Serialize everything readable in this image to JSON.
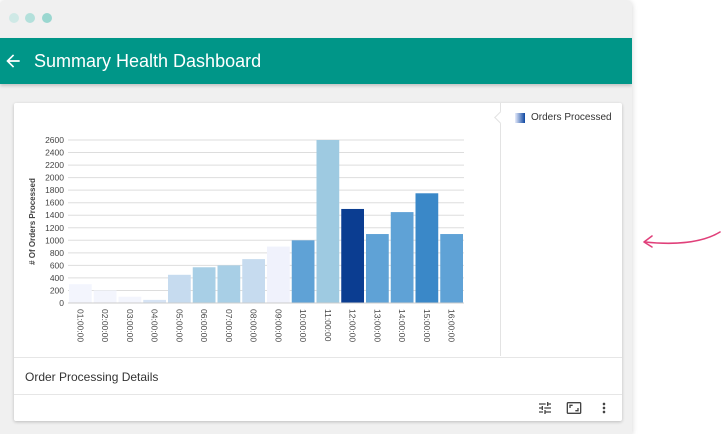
{
  "window": {
    "dots": [
      "#cfe9e6",
      "#b3e0db",
      "#9ad7d0"
    ]
  },
  "header": {
    "title": "Summary Health Dashboard",
    "back_icon": "arrow-left-icon",
    "color": "#009688"
  },
  "legend": {
    "label": "Orders Processed"
  },
  "details": {
    "title": "Order Processing Details"
  },
  "toolbar": {
    "icons": [
      "tune-icon",
      "fullscreen-icon",
      "more-vert-icon"
    ]
  },
  "accent_arrow_color": "#e0407a",
  "chart_data": {
    "type": "bar",
    "categories": [
      "01:00:00",
      "02:00:00",
      "03:00:00",
      "04:00:00",
      "05:00:00",
      "06:00:00",
      "07:00:00",
      "08:00:00",
      "09:00:00",
      "10:00:00",
      "11:00:00",
      "12:00:00",
      "13:00:00",
      "14:00:00",
      "15:00:00",
      "16:00:00"
    ],
    "series": [
      {
        "name": "Orders Processed",
        "values": [
          300,
          200,
          100,
          50,
          450,
          570,
          600,
          700,
          900,
          1000,
          2600,
          1500,
          1100,
          1450,
          1750,
          1100
        ],
        "colors": [
          "#f3f5fd",
          "#f3f5fd",
          "#f3f5fd",
          "#d6e3f4",
          "#c6dbef",
          "#a8cfe6",
          "#a8cfe6",
          "#c6dbef",
          "#f0f2fc",
          "#5fa2d6",
          "#9ecae1",
          "#0b3d91",
          "#5fa2d6",
          "#5fa2d6",
          "#3a88c8",
          "#5fa2d6"
        ]
      }
    ],
    "ylabel": "# Of Orders Processed",
    "xlabel": "",
    "ylim": [
      0,
      2600
    ],
    "yticks": [
      0,
      200,
      400,
      600,
      800,
      1000,
      1200,
      1400,
      1600,
      1800,
      2000,
      2200,
      2400,
      2600
    ],
    "grid": true,
    "legend_position": "right"
  }
}
